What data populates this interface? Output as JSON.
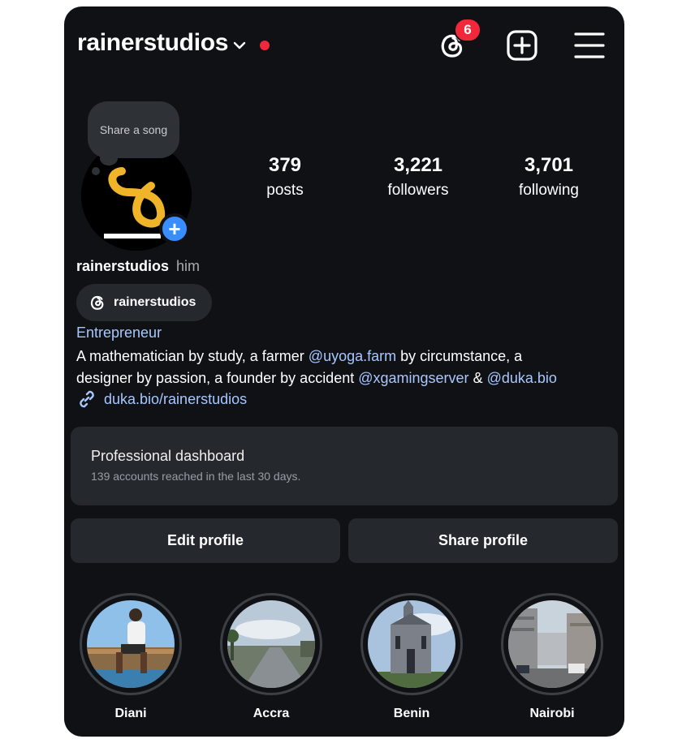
{
  "header": {
    "username": "rainerstudios",
    "notification_count": "6"
  },
  "tooltip": {
    "text": "Share a song"
  },
  "stats": [
    {
      "value": "379",
      "label": "posts"
    },
    {
      "value": "3,221",
      "label": "followers"
    },
    {
      "value": "3,701",
      "label": "following"
    }
  ],
  "profile": {
    "name": "rainerstudios",
    "pronouns": "him",
    "threads_handle": "rainerstudios",
    "category": "Entrepreneur",
    "bio": {
      "line1_a": "A mathematician by study, a farmer ",
      "mention1": "@uyoga.farm",
      "line1_b": " by circumstance, a",
      "line2_a": "designer by passion, a founder by accident ",
      "mention2": "@xgamingserver",
      "line2_b": " & ",
      "mention3": "@duka.bio"
    },
    "link": "duka.bio/rainerstudios"
  },
  "dashboard": {
    "title": "Professional dashboard",
    "subtitle": "139 accounts reached in the last 30 days."
  },
  "buttons": {
    "edit": "Edit profile",
    "share": "Share profile"
  },
  "highlights": [
    {
      "label": "Diani"
    },
    {
      "label": "Accra"
    },
    {
      "label": "Benin"
    },
    {
      "label": "Nairobi"
    }
  ],
  "colors": {
    "background": "#0f1115",
    "accent_link": "#a7c7ff",
    "badge": "#f0283a",
    "add_blue": "#3a8dff",
    "card": "#25282d"
  },
  "icons": [
    "chevron-down-icon",
    "threads-icon",
    "add-post-icon",
    "menu-icon",
    "link-icon",
    "plus-icon"
  ]
}
